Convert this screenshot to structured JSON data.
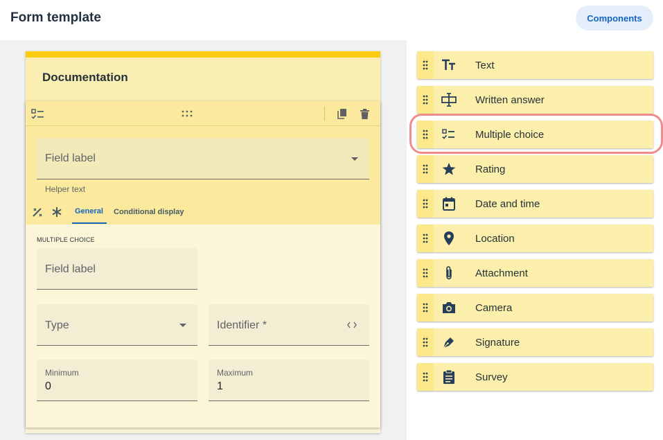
{
  "header": {
    "title": "Form template",
    "components_button": "Components"
  },
  "card": {
    "title": "Documentation"
  },
  "field_editor": {
    "field_label_placeholder": "Field label",
    "helper_text": "Helper text",
    "tabs": [
      "General",
      "Conditional display"
    ],
    "section_label": "MULTIPLE CHOICE",
    "inner_field_label": "Field label",
    "type_label": "Type",
    "identifier_label": "Identifier *",
    "minimum_label": "Minimum",
    "minimum_value": "0",
    "maximum_label": "Maximum",
    "maximum_value": "1"
  },
  "palette": {
    "items": [
      {
        "label": "Text",
        "icon": "text-format-icon"
      },
      {
        "label": "Written answer",
        "icon": "text-input-icon"
      },
      {
        "label": "Multiple choice",
        "icon": "checklist-icon"
      },
      {
        "label": "Rating",
        "icon": "star-icon"
      },
      {
        "label": "Date and time",
        "icon": "calendar-icon"
      },
      {
        "label": "Location",
        "icon": "location-pin-icon"
      },
      {
        "label": "Attachment",
        "icon": "paperclip-icon"
      },
      {
        "label": "Camera",
        "icon": "camera-icon"
      },
      {
        "label": "Signature",
        "icon": "pen-icon"
      },
      {
        "label": "Survey",
        "icon": "clipboard-icon"
      }
    ],
    "highlighted_index": 2
  },
  "colors": {
    "accent": "#1565c0",
    "card_bar": "#fccc11",
    "highlight": "#f28b8b"
  }
}
